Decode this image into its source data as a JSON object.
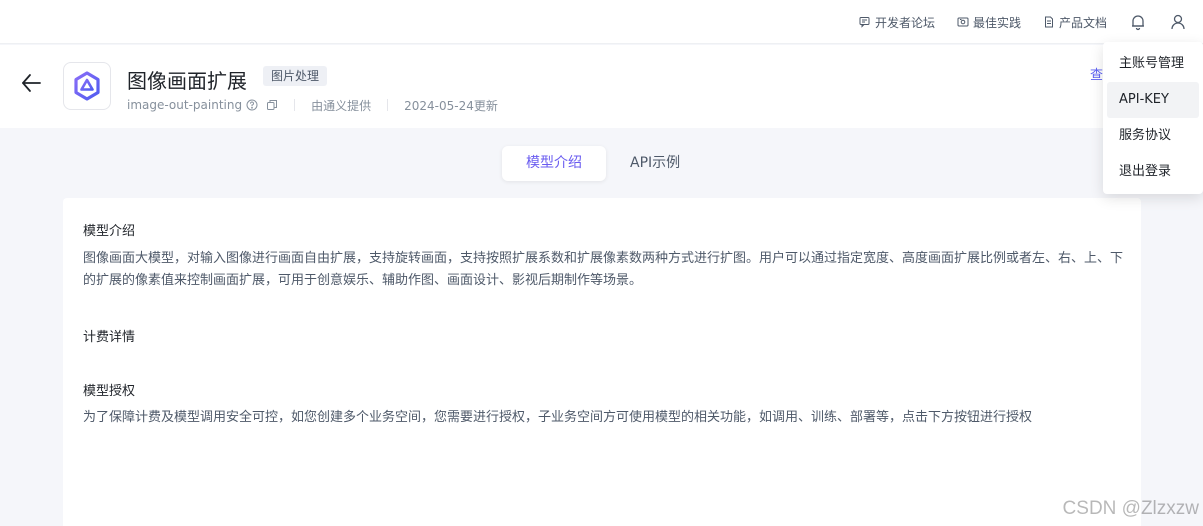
{
  "topbar": {
    "links": [
      {
        "label": "开发者论坛",
        "icon": "forum-icon"
      },
      {
        "label": "最佳实践",
        "icon": "practice-icon"
      },
      {
        "label": "产品文档",
        "icon": "document-icon"
      }
    ]
  },
  "header": {
    "title": "图像画面扩展",
    "tag": "图片处理",
    "model_id": "image-out-painting",
    "provider": "由通义提供",
    "updated": "2024-05-24更新",
    "view_link": "查"
  },
  "tabs": [
    {
      "label": "模型介绍",
      "active": true
    },
    {
      "label": "API示例",
      "active": false
    }
  ],
  "content": {
    "intro_title": "模型介绍",
    "intro_text": "图像画面大模型，对输入图像进行画面自由扩展，支持旋转画面，支持按照扩展系数和扩展像素数两种方式进行扩图。用户可以通过指定宽度、高度画面扩展比例或者左、右、上、下的扩展的像素值来控制画面扩展，可用于创意娱乐、辅助作图、画面设计、影视后期制作等场景。",
    "billing_title": "计费详情",
    "auth_title": "模型授权",
    "auth_text": "为了保障计费及模型调用安全可控，如您创建多个业务空间，您需要进行授权，子业务空间方可使用模型的相关功能，如调用、训练、部署等，点击下方按钮进行授权"
  },
  "dropdown": {
    "items": [
      "主账号管理",
      "API-KEY",
      "服务协议",
      "退出登录"
    ],
    "hovered_index": 1
  },
  "watermark": "CSDN @Zlzxzw",
  "colors": {
    "accent": "#6a5cf0",
    "background": "#f5f6fa"
  }
}
